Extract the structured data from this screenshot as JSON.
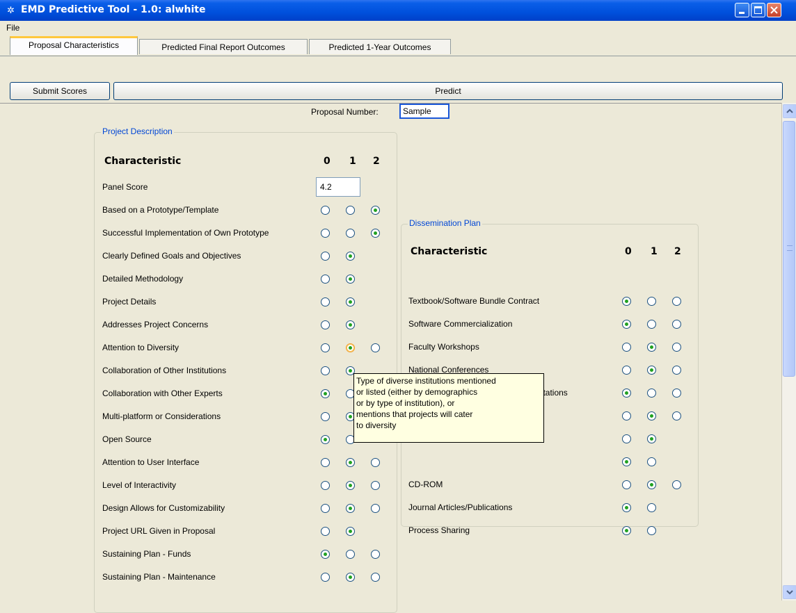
{
  "window": {
    "title": "EMD Predictive Tool - 1.0: alwhite",
    "app_icon": "gear-icon"
  },
  "menu": {
    "file_label": "File"
  },
  "tabs": [
    {
      "label": "Proposal Characteristics",
      "active": true
    },
    {
      "label": "Predicted Final Report Outcomes",
      "active": false
    },
    {
      "label": "Predicted 1-Year Outcomes",
      "active": false
    }
  ],
  "toolbar": {
    "submit_label": "Submit Scores",
    "predict_label": "Predict"
  },
  "proposal": {
    "number_label": "Proposal Number:",
    "number_value": "Sample"
  },
  "project_description": {
    "title": "Project Description",
    "header": {
      "characteristic": "Characteristic",
      "c0": "0",
      "c1": "1",
      "c2": "2"
    },
    "panel_score_label": "Panel Score",
    "panel_score_value": "4.2",
    "rows": [
      {
        "label": "Based on a Prototype/Template",
        "options": 3,
        "selected": 2
      },
      {
        "label": "Successful Implementation of Own Prototype",
        "options": 3,
        "selected": 2
      },
      {
        "label": "Clearly Defined Goals and Objectives",
        "options": 2,
        "selected": 1
      },
      {
        "label": "Detailed Methodology",
        "options": 2,
        "selected": 1
      },
      {
        "label": "Project Details",
        "options": 2,
        "selected": 1
      },
      {
        "label": "Addresses Project Concerns",
        "options": 2,
        "selected": 1
      },
      {
        "label": "Attention to Diversity",
        "options": 3,
        "selected": 1
      },
      {
        "label": "Collaboration of Other Institutions",
        "options": 2,
        "selected": 1
      },
      {
        "label": "Collaboration with Other Experts",
        "options": 2,
        "selected": 0
      },
      {
        "label": "Multi-platform or Considerations",
        "options": 2,
        "selected": 1
      },
      {
        "label": "Open Source",
        "options": 2,
        "selected": 0
      },
      {
        "label": "Attention to User Interface",
        "options": 3,
        "selected": 1
      },
      {
        "label": "Level of Interactivity",
        "options": 3,
        "selected": 1
      },
      {
        "label": "Design Allows for Customizability",
        "options": 3,
        "selected": 1
      },
      {
        "label": "Project URL Given in Proposal",
        "options": 2,
        "selected": 1
      },
      {
        "label": "Sustaining Plan - Funds",
        "options": 3,
        "selected": 0
      },
      {
        "label": "Sustaining Plan - Maintenance",
        "options": 3,
        "selected": 1
      }
    ]
  },
  "dissemination_plan": {
    "title": "Dissemination Plan",
    "header": {
      "characteristic": "Characteristic",
      "c0": "0",
      "c1": "1",
      "c2": "2"
    },
    "rows": [
      {
        "label": "Textbook/Software Bundle Contract",
        "options": 3,
        "selected": 0
      },
      {
        "label": "Software Commercialization",
        "options": 3,
        "selected": 0
      },
      {
        "label": "Faculty Workshops",
        "options": 3,
        "selected": 1
      },
      {
        "label": "National Conferences",
        "options": 3,
        "selected": 1
      },
      {
        "label": "Local Conferences/Meetings/Presentations",
        "options": 3,
        "selected": 0
      },
      {
        "label": "",
        "options": 3,
        "selected": 1
      },
      {
        "label": "",
        "options": 2,
        "selected": 1
      },
      {
        "label": "",
        "options": 2,
        "selected": 0
      },
      {
        "label": "CD-ROM",
        "options": 3,
        "selected": 1
      },
      {
        "label": "Journal Articles/Publications",
        "options": 2,
        "selected": 0
      },
      {
        "label": "Process Sharing",
        "options": 2,
        "selected": 0
      }
    ]
  },
  "tooltip": {
    "lines": [
      "Type of diverse institutions mentioned",
      "or listed (either by demographics",
      "or by type of institution), or",
      "mentions that projects will cater",
      "to diversity"
    ]
  }
}
